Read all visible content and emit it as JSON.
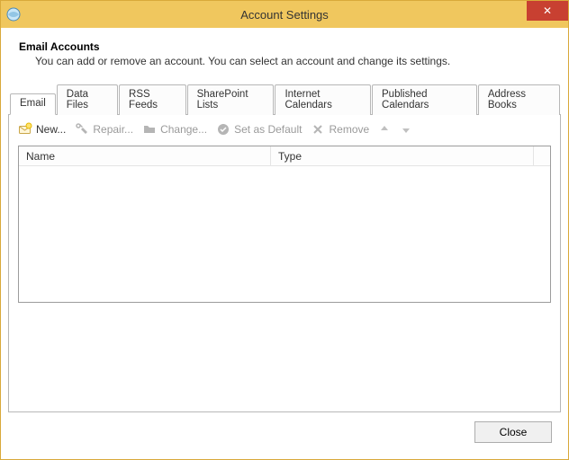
{
  "window": {
    "title": "Account Settings",
    "close_glyph": "✕"
  },
  "header": {
    "title": "Email Accounts",
    "description": "You can add or remove an account. You can select an account and change its settings."
  },
  "tabs": [
    {
      "label": "Email",
      "active": true
    },
    {
      "label": "Data Files",
      "active": false
    },
    {
      "label": "RSS Feeds",
      "active": false
    },
    {
      "label": "SharePoint Lists",
      "active": false
    },
    {
      "label": "Internet Calendars",
      "active": false
    },
    {
      "label": "Published Calendars",
      "active": false
    },
    {
      "label": "Address Books",
      "active": false
    }
  ],
  "toolbar": {
    "new_label": "New...",
    "repair_label": "Repair...",
    "change_label": "Change...",
    "default_label": "Set as Default",
    "remove_label": "Remove"
  },
  "columns": {
    "name": "Name",
    "type": "Type"
  },
  "footer": {
    "close_label": "Close"
  }
}
